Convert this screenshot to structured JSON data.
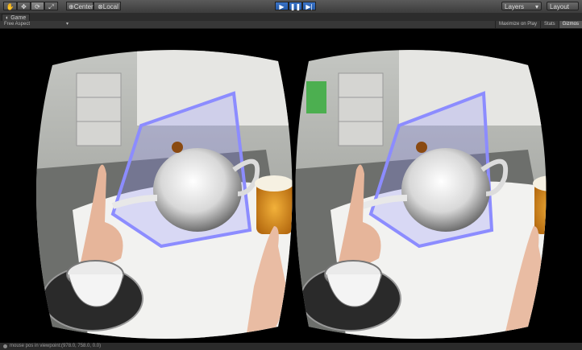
{
  "toolbar": {
    "tools": [
      {
        "name": "hand-tool",
        "icon": "hand-icon",
        "glyph": "✋"
      },
      {
        "name": "move-tool",
        "icon": "move-icon",
        "glyph": "✥"
      },
      {
        "name": "rotate-tool",
        "icon": "rotate-icon",
        "glyph": "⟳"
      },
      {
        "name": "scale-tool",
        "icon": "scale-icon",
        "glyph": "⤢"
      }
    ],
    "pivot_label": "Center",
    "space_label": "Local",
    "play_glyph": "▶",
    "pause_glyph": "❚❚",
    "step_glyph": "▶|",
    "layers_label": "Layers",
    "layout_label": "Layout",
    "accent_color": "#2f66ba"
  },
  "tab": {
    "title": "Game",
    "icon": "game-tab-icon"
  },
  "game_bar": {
    "aspect": "Free Aspect",
    "aspect_arrow": "▾",
    "maximize": "Maximize on Play",
    "stats": "Stats",
    "gizmos": "Gizmos"
  },
  "viewport": {
    "description_icon": "stereo-vr-view",
    "teapot_color": "#ffffff",
    "frame_color": "#8c8cff"
  },
  "status": {
    "message": "mouse pos in viewpoint:(978.0, 758.0, 0.0)"
  }
}
